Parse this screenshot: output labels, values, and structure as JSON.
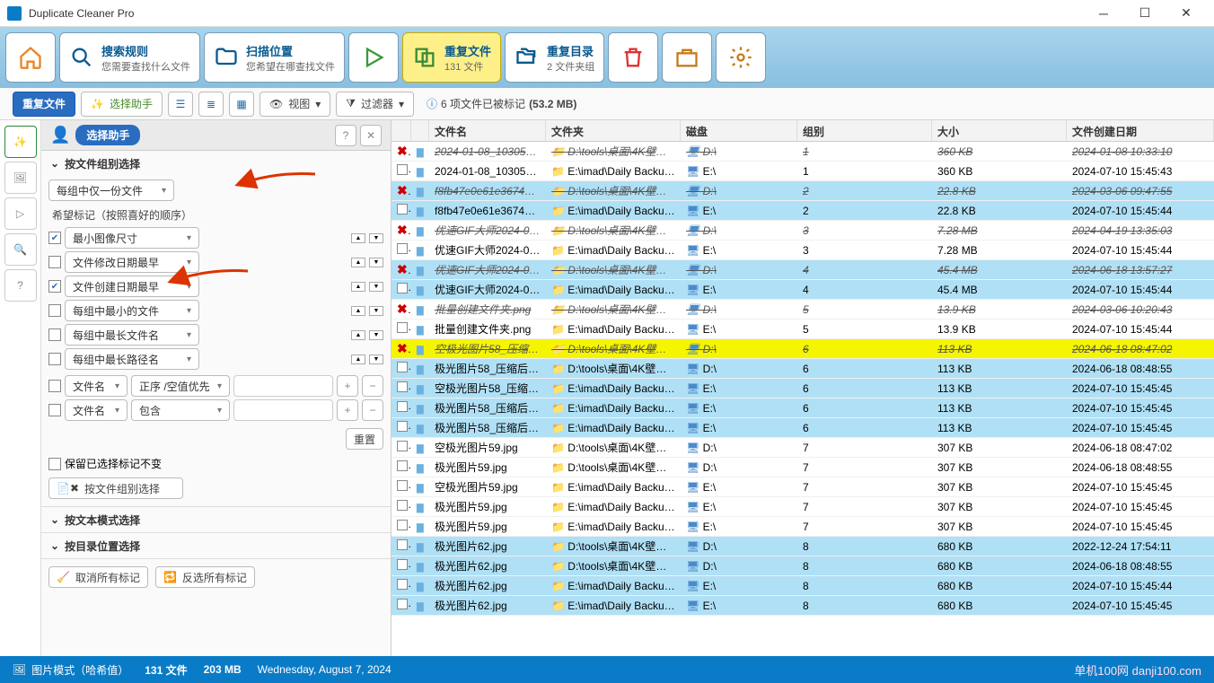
{
  "app": {
    "title": "Duplicate Cleaner Pro"
  },
  "ribbon": {
    "home": "",
    "rules": {
      "title": "搜索规则",
      "sub": "您需要查找什么文件"
    },
    "location": {
      "title": "扫描位置",
      "sub": "您希望在哪查找文件"
    },
    "dup_files": {
      "title": "重复文件",
      "sub": "131 文件"
    },
    "dup_dirs": {
      "title": "重复目录",
      "sub": "2 文件夹组"
    }
  },
  "subbar": {
    "dup_btn": "重复文件",
    "helper": "选择助手",
    "view": "视图",
    "view_caret": " ▾",
    "filter": "过滤器",
    "filter_caret": " ▾",
    "status_prefix": "6 项文件已被标记",
    "status_size": " (53.2 MB)"
  },
  "leftpanel": {
    "header_title": "选择助手",
    "section_group": "按文件组别选择",
    "keep_one_per_group": "每组中仅一份文件",
    "pref_order_label": "希望标记（按照喜好的顺序）",
    "criteria": [
      {
        "label": "最小图像尺寸",
        "checked": true
      },
      {
        "label": "文件修改日期最早",
        "checked": false
      },
      {
        "label": "文件创建日期最早",
        "checked": true
      },
      {
        "label": "每组中最小的文件",
        "checked": false
      },
      {
        "label": "每组中最长文件名",
        "checked": false
      },
      {
        "label": "每组中最长路径名",
        "checked": false
      }
    ],
    "extra": [
      {
        "a": "文件名",
        "b": "正序 /空值优先"
      },
      {
        "a": "文件名",
        "b": "包含"
      }
    ],
    "reset": "重置",
    "keep_marks": "保留已选择标记不变",
    "apply_btn": "按文件组别选择",
    "section_text": "按文本模式选择",
    "section_dir": "按目录位置选择",
    "unmark_all": "取消所有标记",
    "invert": "反选所有标记"
  },
  "grid": {
    "headers": {
      "name": "文件名",
      "folder": "文件夹",
      "disk": "磁盘",
      "group": "组别",
      "size": "大小",
      "date": "文件创建日期"
    },
    "rows": [
      {
        "mark": true,
        "name": "2024-01-08_103059.p...",
        "folder": "D:\\tools\\桌面\\4K壁纸...",
        "disk": "D:\\",
        "group": "1",
        "size": "360 KB",
        "date": "2024-01-08 10:33:10",
        "strike": true,
        "cls": "alt0"
      },
      {
        "mark": false,
        "name": "2024-01-08_103059.p...",
        "folder": "E:\\imad\\Daily Backups...",
        "disk": "E:\\",
        "group": "1",
        "size": "360 KB",
        "date": "2024-07-10 15:45:43",
        "strike": false,
        "cls": "alt0"
      },
      {
        "mark": true,
        "name": "f8fb47e0e61e36743c1...",
        "folder": "D:\\tools\\桌面\\4K壁纸...",
        "disk": "D:\\",
        "group": "2",
        "size": "22.8 KB",
        "date": "2024-03-06 09:47:55",
        "strike": true,
        "cls": "sel"
      },
      {
        "mark": false,
        "name": "f8fb47e0e61e36743c...",
        "folder": "E:\\imad\\Daily Backups...",
        "disk": "E:\\",
        "group": "2",
        "size": "22.8 KB",
        "date": "2024-07-10 15:45:44",
        "strike": false,
        "cls": "sel"
      },
      {
        "mark": true,
        "name": "优速GIF大师2024-04-...",
        "folder": "D:\\tools\\桌面\\4K壁纸...",
        "disk": "D:\\",
        "group": "3",
        "size": "7.28 MB",
        "date": "2024-04-19 13:35:03",
        "strike": true,
        "cls": "alt0"
      },
      {
        "mark": false,
        "name": "优速GIF大师2024-04-...",
        "folder": "E:\\imad\\Daily Backups...",
        "disk": "E:\\",
        "group": "3",
        "size": "7.28 MB",
        "date": "2024-07-10 15:45:44",
        "strike": false,
        "cls": "alt0"
      },
      {
        "mark": true,
        "name": "优速GIF大师2024-06-...",
        "folder": "D:\\tools\\桌面\\4K壁纸...",
        "disk": "D:\\",
        "group": "4",
        "size": "45.4 MB",
        "date": "2024-06-18 13:57:27",
        "strike": true,
        "cls": "sel"
      },
      {
        "mark": false,
        "name": "优速GIF大师2024-06-...",
        "folder": "E:\\imad\\Daily Backups...",
        "disk": "E:\\",
        "group": "4",
        "size": "45.4 MB",
        "date": "2024-07-10 15:45:44",
        "strike": false,
        "cls": "sel"
      },
      {
        "mark": true,
        "name": "批量创建文件夹.png",
        "folder": "D:\\tools\\桌面\\4K壁纸...",
        "disk": "D:\\",
        "group": "5",
        "size": "13.9 KB",
        "date": "2024-03-06 10:20:43",
        "strike": true,
        "cls": "alt0"
      },
      {
        "mark": false,
        "name": "批量创建文件夹.png",
        "folder": "E:\\imad\\Daily Backups...",
        "disk": "E:\\",
        "group": "5",
        "size": "13.9 KB",
        "date": "2024-07-10 15:45:44",
        "strike": false,
        "cls": "alt0"
      },
      {
        "mark": true,
        "name": "空极光图片58_压缩后....",
        "folder": "D:\\tools\\桌面\\4K壁纸...",
        "disk": "D:\\",
        "group": "6",
        "size": "113 KB",
        "date": "2024-06-18 08:47:02",
        "strike": true,
        "cls": "yellow"
      },
      {
        "mark": false,
        "name": "极光图片58_压缩后.jpg",
        "folder": "D:\\tools\\桌面\\4K壁纸...",
        "disk": "D:\\",
        "group": "6",
        "size": "113 KB",
        "date": "2024-06-18 08:48:55",
        "strike": false,
        "cls": "sel"
      },
      {
        "mark": false,
        "name": "空极光图片58_压缩后....",
        "folder": "E:\\imad\\Daily Backups...",
        "disk": "E:\\",
        "group": "6",
        "size": "113 KB",
        "date": "2024-07-10 15:45:45",
        "strike": false,
        "cls": "sel"
      },
      {
        "mark": false,
        "name": "极光图片58_压缩后.jpg",
        "folder": "E:\\imad\\Daily Backups...",
        "disk": "E:\\",
        "group": "6",
        "size": "113 KB",
        "date": "2024-07-10 15:45:45",
        "strike": false,
        "cls": "sel"
      },
      {
        "mark": false,
        "name": "极光图片58_压缩后.jpg",
        "folder": "E:\\imad\\Daily Backups...",
        "disk": "E:\\",
        "group": "6",
        "size": "113 KB",
        "date": "2024-07-10 15:45:45",
        "strike": false,
        "cls": "sel"
      },
      {
        "mark": false,
        "name": "空极光图片59.jpg",
        "folder": "D:\\tools\\桌面\\4K壁纸...",
        "disk": "D:\\",
        "group": "7",
        "size": "307 KB",
        "date": "2024-06-18 08:47:02",
        "strike": false,
        "cls": "alt0"
      },
      {
        "mark": false,
        "name": "极光图片59.jpg",
        "folder": "D:\\tools\\桌面\\4K壁纸...",
        "disk": "D:\\",
        "group": "7",
        "size": "307 KB",
        "date": "2024-06-18 08:48:55",
        "strike": false,
        "cls": "alt0"
      },
      {
        "mark": false,
        "name": "空极光图片59.jpg",
        "folder": "E:\\imad\\Daily Backups...",
        "disk": "E:\\",
        "group": "7",
        "size": "307 KB",
        "date": "2024-07-10 15:45:45",
        "strike": false,
        "cls": "alt0"
      },
      {
        "mark": false,
        "name": "极光图片59.jpg",
        "folder": "E:\\imad\\Daily Backups...",
        "disk": "E:\\",
        "group": "7",
        "size": "307 KB",
        "date": "2024-07-10 15:45:45",
        "strike": false,
        "cls": "alt0"
      },
      {
        "mark": false,
        "name": "极光图片59.jpg",
        "folder": "E:\\imad\\Daily Backups...",
        "disk": "E:\\",
        "group": "7",
        "size": "307 KB",
        "date": "2024-07-10 15:45:45",
        "strike": false,
        "cls": "alt0"
      },
      {
        "mark": false,
        "name": "极光图片62.jpg",
        "folder": "D:\\tools\\桌面\\4K壁纸...",
        "disk": "D:\\",
        "group": "8",
        "size": "680 KB",
        "date": "2022-12-24 17:54:11",
        "strike": false,
        "cls": "sel"
      },
      {
        "mark": false,
        "name": "极光图片62.jpg",
        "folder": "D:\\tools\\桌面\\4K壁纸...",
        "disk": "D:\\",
        "group": "8",
        "size": "680 KB",
        "date": "2024-06-18 08:48:55",
        "strike": false,
        "cls": "sel"
      },
      {
        "mark": false,
        "name": "极光图片62.jpg",
        "folder": "E:\\imad\\Daily Backups...",
        "disk": "E:\\",
        "group": "8",
        "size": "680 KB",
        "date": "2024-07-10 15:45:44",
        "strike": false,
        "cls": "sel"
      },
      {
        "mark": false,
        "name": "极光图片62.jpg",
        "folder": "E:\\imad\\Daily Backups...",
        "disk": "E:\\",
        "group": "8",
        "size": "680 KB",
        "date": "2024-07-10 15:45:45",
        "strike": false,
        "cls": "sel"
      }
    ]
  },
  "status": {
    "mode": "图片模式（哈希值）",
    "files": "131 文件",
    "size": "203 MB",
    "date": "Wednesday, August 7, 2024",
    "watermark": "单机100网  danji100.com"
  }
}
